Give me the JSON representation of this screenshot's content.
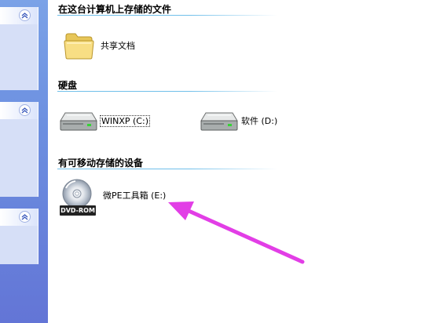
{
  "groups": {
    "stored": {
      "title": "在这台计算机上存储的文件",
      "items": [
        {
          "label": "共享文档",
          "icon": "folder-icon"
        }
      ]
    },
    "disks": {
      "title": "硬盘",
      "items": [
        {
          "label": "WINXP (C:)",
          "icon": "hard-drive-icon",
          "focused": true
        },
        {
          "label": "软件 (D:)",
          "icon": "hard-drive-icon"
        }
      ]
    },
    "removable": {
      "title": "有可移动存储的设备",
      "items": [
        {
          "label": "微PE工具箱 (E:)",
          "icon": "cd-rom-icon",
          "badge": "DVD-ROM"
        }
      ]
    }
  },
  "colors": {
    "taskpane": "#6c8fe0",
    "group_line": "#70bfea",
    "annotation_arrow": "#e23ee6"
  }
}
